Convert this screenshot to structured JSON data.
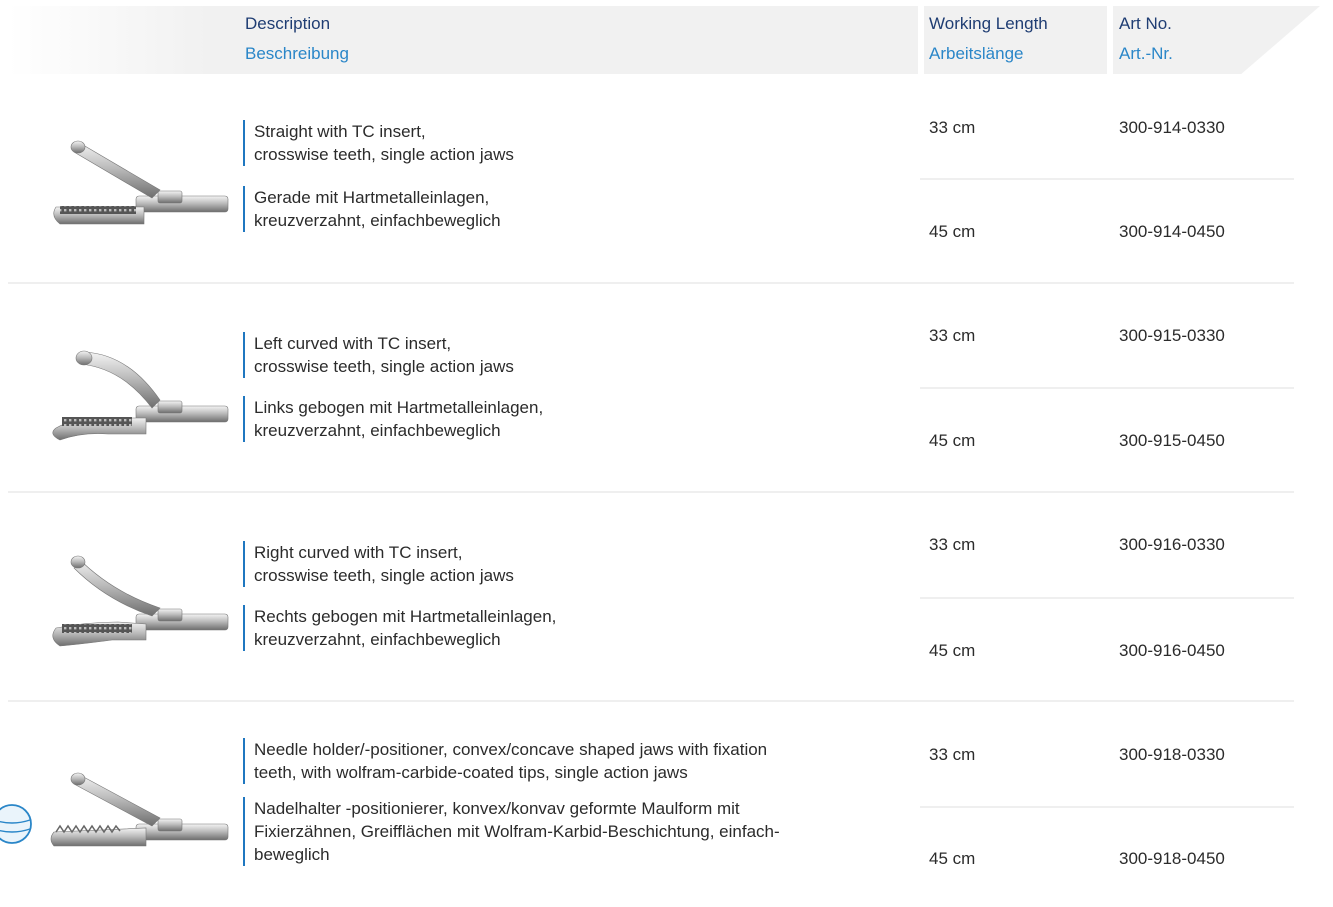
{
  "header": {
    "description_en": "Description",
    "description_de": "Beschreibung",
    "length_en": "Working Length",
    "length_de": "Arbeitslänge",
    "artno_en": "Art No.",
    "artno_de": "Art.-Nr."
  },
  "products": [
    {
      "icon": "straight-forceps",
      "desc_en": [
        "Straight with TC insert,",
        "crosswise teeth, single action jaws"
      ],
      "desc_de": [
        "Gerade mit Hartmetalleinlagen,",
        "kreuzverzahnt, einfachbeweglich"
      ],
      "variants": [
        {
          "length": "33 cm",
          "art": "300-914-0330"
        },
        {
          "length": "45 cm",
          "art": "300-914-0450"
        }
      ]
    },
    {
      "icon": "left-curved-forceps",
      "desc_en": [
        "Left curved with TC insert,",
        "crosswise teeth, single action jaws"
      ],
      "desc_de": [
        "Links gebogen mit Hartmetalleinlagen,",
        "kreuzverzahnt, einfachbeweglich"
      ],
      "variants": [
        {
          "length": "33 cm",
          "art": "300-915-0330"
        },
        {
          "length": "45 cm",
          "art": "300-915-0450"
        }
      ]
    },
    {
      "icon": "right-curved-forceps",
      "desc_en": [
        "Right curved with TC insert,",
        "crosswise teeth, single action jaws"
      ],
      "desc_de": [
        "Rechts gebogen mit Hartmetalleinlagen,",
        "kreuzverzahnt, einfachbeweglich"
      ],
      "variants": [
        {
          "length": "33 cm",
          "art": "300-916-0330"
        },
        {
          "length": "45 cm",
          "art": "300-916-0450"
        }
      ]
    },
    {
      "icon": "needle-holder",
      "desc_en": [
        "Needle holder/-positioner, convex/concave shaped jaws with fixation",
        "teeth, with wolfram-carbide-coated tips, single action jaws"
      ],
      "desc_de": [
        "Nadelhalter -positionierer, konvex/konvav geformte Maulform mit",
        "Fixierzähnen, Greifflächen mit Wolfram-Karbid-Beschichtung, einfach-",
        "beweglich"
      ],
      "variants": [
        {
          "length": "33 cm",
          "art": "300-918-0330"
        },
        {
          "length": "45 cm",
          "art": "300-918-0450"
        }
      ]
    }
  ]
}
